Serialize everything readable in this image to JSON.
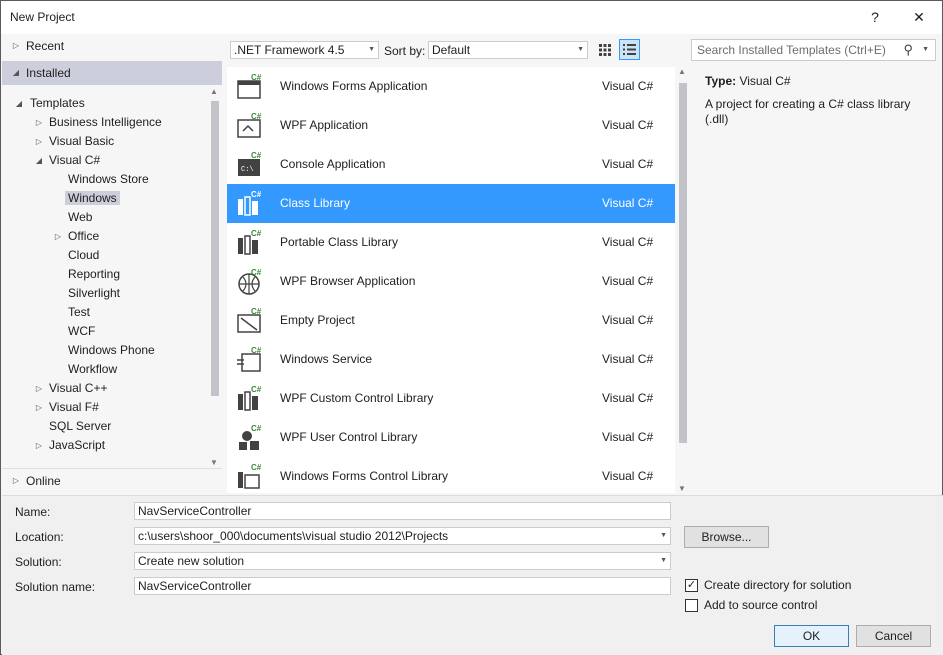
{
  "window": {
    "title": "New Project",
    "help_label": "?",
    "close_label": "✕"
  },
  "tree": {
    "recent": "Recent",
    "installed": "Installed",
    "templates": "Templates",
    "items": [
      {
        "label": "Business Intelligence"
      },
      {
        "label": "Visual Basic"
      },
      {
        "label": "Visual C#"
      },
      {
        "label": "Windows Store"
      },
      {
        "label": "Windows"
      },
      {
        "label": "Web"
      },
      {
        "label": "Office"
      },
      {
        "label": "Cloud"
      },
      {
        "label": "Reporting"
      },
      {
        "label": "Silverlight"
      },
      {
        "label": "Test"
      },
      {
        "label": "WCF"
      },
      {
        "label": "Windows Phone"
      },
      {
        "label": "Workflow"
      },
      {
        "label": "Visual C++"
      },
      {
        "label": "Visual F#"
      },
      {
        "label": "SQL Server"
      },
      {
        "label": "JavaScript"
      }
    ],
    "online": "Online"
  },
  "toolbar": {
    "framework": ".NET Framework 4.5",
    "sort_label": "Sort by:",
    "sort_value": "Default",
    "search_placeholder": "Search Installed Templates (Ctrl+E)"
  },
  "templates": [
    {
      "name": "Windows Forms Application",
      "lang": "Visual C#",
      "icon": "windows-forms-icon"
    },
    {
      "name": "WPF Application",
      "lang": "Visual C#",
      "icon": "wpf-app-icon"
    },
    {
      "name": "Console Application",
      "lang": "Visual C#",
      "icon": "console-icon"
    },
    {
      "name": "Class Library",
      "lang": "Visual C#",
      "icon": "class-library-icon",
      "selected": true
    },
    {
      "name": "Portable Class Library",
      "lang": "Visual C#",
      "icon": "portable-library-icon"
    },
    {
      "name": "WPF Browser Application",
      "lang": "Visual C#",
      "icon": "globe-icon"
    },
    {
      "name": "Empty Project",
      "lang": "Visual C#",
      "icon": "empty-project-icon"
    },
    {
      "name": "Windows Service",
      "lang": "Visual C#",
      "icon": "windows-service-icon"
    },
    {
      "name": "WPF Custom Control Library",
      "lang": "Visual C#",
      "icon": "custom-control-icon"
    },
    {
      "name": "WPF User Control Library",
      "lang": "Visual C#",
      "icon": "user-control-icon"
    },
    {
      "name": "Windows Forms Control Library",
      "lang": "Visual C#",
      "icon": "forms-control-icon"
    }
  ],
  "info": {
    "type_label": "Type:",
    "type_value": "Visual C#",
    "description": "A project for creating a C# class library (.dll)"
  },
  "form": {
    "name_label": "Name:",
    "name_value": "NavServiceController",
    "location_label": "Location:",
    "location_value": "c:\\users\\shoor_000\\documents\\visual studio 2012\\Projects",
    "solution_label": "Solution:",
    "solution_value": "Create new solution",
    "solution_name_label": "Solution name:",
    "solution_name_value": "NavServiceController",
    "browse_label": "Browse...",
    "create_dir_label": "Create directory for solution",
    "create_dir_checked": true,
    "source_control_label": "Add to source control",
    "source_control_checked": false,
    "ok_label": "OK",
    "cancel_label": "Cancel"
  },
  "colors": {
    "selection": "#3399ff",
    "installed_bg": "#cccedb",
    "csharp_badge": "#388a34"
  }
}
